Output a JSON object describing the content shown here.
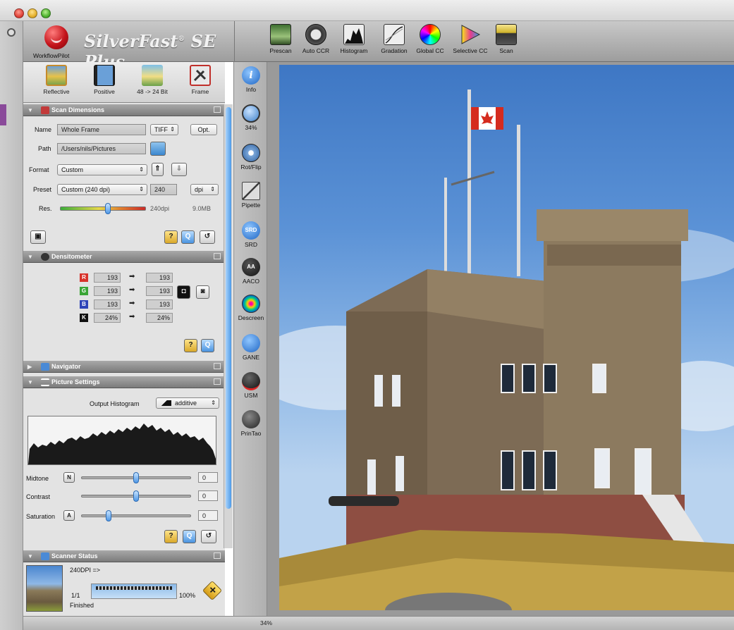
{
  "app": {
    "brand": "SilverFast",
    "brand_suffix": "SE Plus",
    "brand_mark": "®",
    "workflow_label": "WorkflowPilot"
  },
  "toolbar": {
    "buttons": [
      {
        "label": "Prescan",
        "icon": "prescan-icon"
      },
      {
        "label": "Auto CCR",
        "icon": "auto-ccr-icon"
      },
      {
        "label": "Histogram",
        "icon": "histogram-icon"
      },
      {
        "label": "Gradation",
        "icon": "gradation-icon"
      },
      {
        "label": "Global CC",
        "icon": "color-wheel-icon"
      },
      {
        "label": "Selective CC",
        "icon": "selective-cc-icon"
      },
      {
        "label": "Scan",
        "icon": "scan-icon"
      }
    ]
  },
  "modes": [
    {
      "label": "Reflective",
      "icon": "reflective-icon"
    },
    {
      "label": "Positive",
      "icon": "film-icon"
    },
    {
      "label": "48 -> 24 Bit",
      "icon": "bitdepth-icon"
    },
    {
      "label": "Frame",
      "icon": "frame-icon"
    }
  ],
  "scan_dimensions": {
    "title": "Scan Dimensions",
    "name_label": "Name",
    "name_value": "Whole Frame",
    "file_type": "TIFF",
    "opt_label": "Opt.",
    "path_label": "Path",
    "path_value": "/Users/nils/Pictures",
    "format_label": "Format",
    "format_value": "Custom",
    "preset_label": "Preset",
    "preset_value": "Custom (240 dpi)",
    "dpi_value": "240",
    "dpi_unit": "dpi",
    "res_label": "Res.",
    "res_value": "240dpi",
    "file_size": "9.0MB",
    "res_slider_fraction": 0.56
  },
  "densitometer": {
    "title": "Densitometer",
    "rows": [
      {
        "channel": "R",
        "color": "#d8322a",
        "before": "193",
        "after": "193"
      },
      {
        "channel": "G",
        "color": "#3aa535",
        "before": "193",
        "after": "193"
      },
      {
        "channel": "B",
        "color": "#2e44b8",
        "before": "193",
        "after": "193"
      },
      {
        "channel": "K",
        "color": "#111111",
        "before": "24%",
        "after": "24%"
      }
    ]
  },
  "navigator": {
    "title": "Navigator"
  },
  "picture_settings": {
    "title": "Picture Settings",
    "histogram_label": "Output Histogram",
    "histogram_mode": "additive",
    "sliders": [
      {
        "label": "Midtone",
        "badge": "N",
        "value": "0",
        "fraction": 0.5
      },
      {
        "label": "Contrast",
        "badge": "",
        "value": "0",
        "fraction": 0.5
      },
      {
        "label": "Saturation",
        "badge": "A",
        "value": "0",
        "fraction": 0.25
      }
    ]
  },
  "scanner_status": {
    "title": "Scanner Status",
    "resolution": "240DPI =>",
    "count": "1/1",
    "percent": "100%",
    "progress": 1.0,
    "state": "Finished"
  },
  "tools": [
    {
      "label": "Info",
      "icon": "info-icon"
    },
    {
      "label": "34%",
      "icon": "zoom-icon"
    },
    {
      "label": "Rot/Flip",
      "icon": "compass-icon"
    },
    {
      "label": "Pipette",
      "icon": "pipette-icon"
    },
    {
      "label": "SRD",
      "icon": "srd-icon"
    },
    {
      "label": "AACO",
      "icon": "aaco-icon"
    },
    {
      "label": "Descreen",
      "icon": "descreen-icon"
    },
    {
      "label": "GANE",
      "icon": "gane-icon"
    },
    {
      "label": "USM",
      "icon": "usm-icon"
    },
    {
      "label": "PrinTao",
      "icon": "printao-icon"
    }
  ],
  "status_bar": {
    "zoom": "34%"
  }
}
